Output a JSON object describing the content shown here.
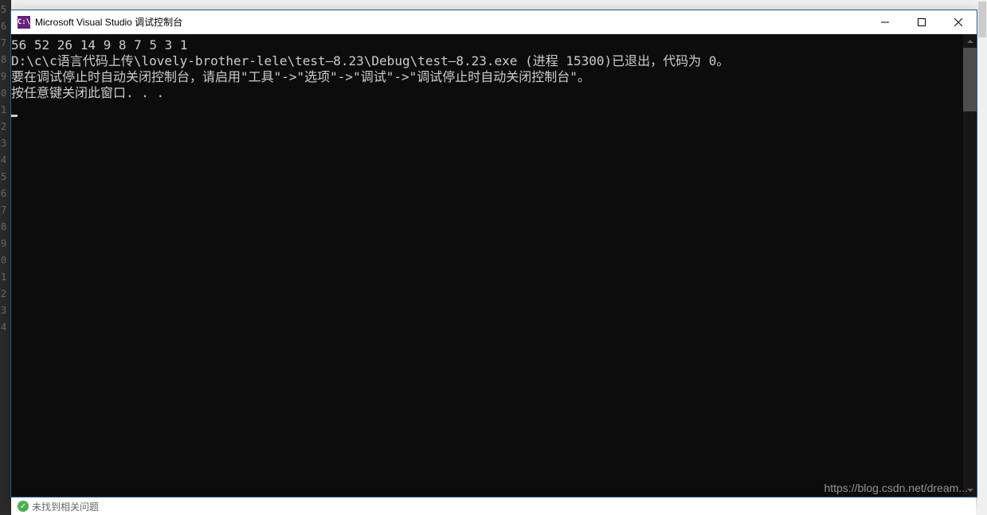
{
  "gutter_lines": [
    "5",
    "6",
    "7",
    "8",
    "9",
    "0",
    "1",
    "2",
    "3",
    "4",
    "5",
    "6",
    "7",
    "8",
    "9",
    "0",
    "1",
    "2",
    "3",
    "4"
  ],
  "window": {
    "app_icon_text": "C:\\",
    "title": "Microsoft Visual Studio 调试控制台"
  },
  "console": {
    "lines": [
      "56 52 26 14 9 8 7 5 3 1",
      "D:\\c\\c语言代码上传\\lovely-brother-lele\\test—8.23\\Debug\\test—8.23.exe (进程 15300)已退出，代码为 0。",
      "要在调试停止时自动关闭控制台，请启用\"工具\"->\"选项\"->\"调试\"->\"调试停止时自动关闭控制台\"。",
      "按任意键关闭此窗口. . ."
    ]
  },
  "statusbar": {
    "msg": "未找到相关问题"
  },
  "watermark": "https://blog.csdn.net/dream..."
}
